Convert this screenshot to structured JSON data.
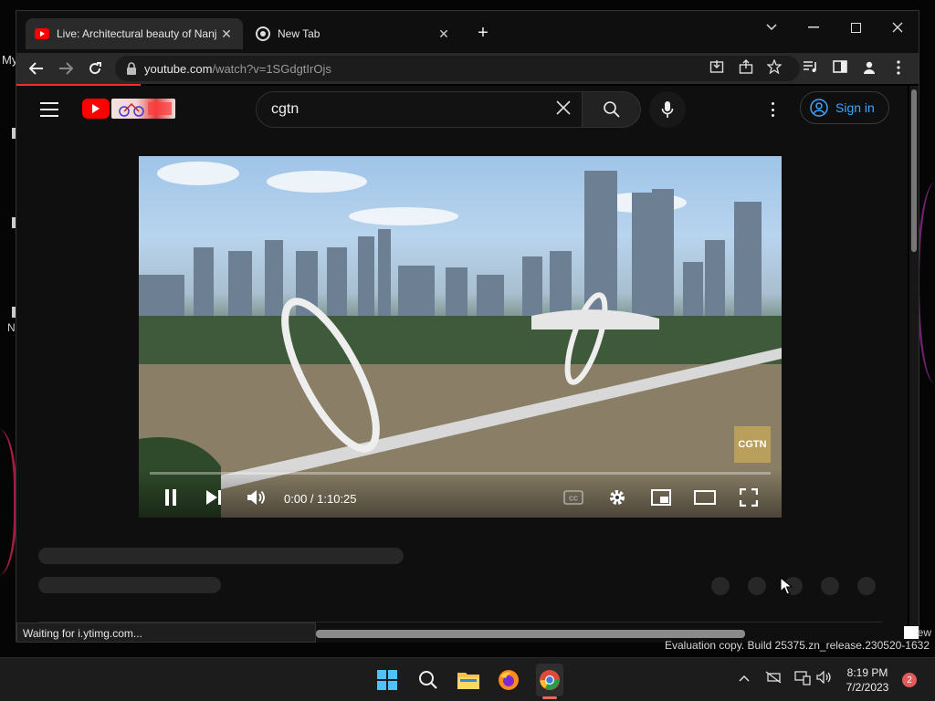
{
  "desktop": {
    "left_label_top": "My",
    "left_label_bottom": "N"
  },
  "browser": {
    "tabs": [
      {
        "title": "Live: Architectural beauty of Nanj",
        "active": true,
        "favicon": "youtube-icon"
      },
      {
        "title": "New Tab",
        "active": false,
        "favicon": "chrome-icon"
      }
    ],
    "url_host": "youtube.com",
    "url_path": "/watch?v=1SGdgtIrOjs",
    "status_text": "Waiting for i.ytimg.com..."
  },
  "youtube": {
    "search_query": "cgtn",
    "sign_in_label": "Sign in",
    "accent_color": "#ff0000",
    "link_color": "#3ea6ff"
  },
  "player": {
    "timecode": "0:00 / 1:10:25",
    "watermark": "CGTN",
    "progress": 0
  },
  "system": {
    "evaluation_text": "Evaluation copy. Build 25375.zn_release.230520-1632",
    "ew_text": "ew",
    "time": "8:19 PM",
    "date": "7/2/2023",
    "notification_count": "2"
  }
}
